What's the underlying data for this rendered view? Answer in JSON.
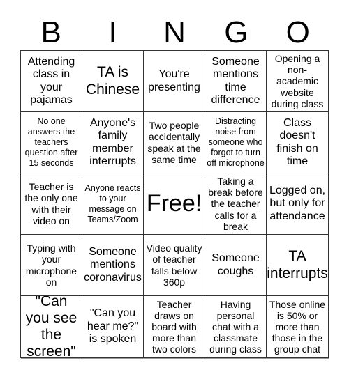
{
  "header": {
    "letters": [
      "B",
      "I",
      "N",
      "G",
      "O"
    ]
  },
  "card": {
    "cells": [
      {
        "text": "Attending class in your pajamas",
        "size": "m"
      },
      {
        "text": "TA is Chinese",
        "size": "l"
      },
      {
        "text": "You're presenting",
        "size": "m"
      },
      {
        "text": "Someone mentions time difference",
        "size": "m"
      },
      {
        "text": "Opening a non-academic website during class",
        "size": "sm"
      },
      {
        "text": "No one answers the teachers question after 15 seconds",
        "size": "s"
      },
      {
        "text": "Anyone's family member interrupts",
        "size": "m"
      },
      {
        "text": "Two people accidentally speak at the same time",
        "size": "sm"
      },
      {
        "text": "Distracting noise from someone who forgot to turn off microphone",
        "size": "s"
      },
      {
        "text": "Class doesn't finish on time",
        "size": "m"
      },
      {
        "text": "Teacher is the only one with their video on",
        "size": "sm"
      },
      {
        "text": "Anyone reacts to your message on Teams/Zoom",
        "size": "s"
      },
      {
        "text": "Free!",
        "size": "xl"
      },
      {
        "text": "Taking a break before the teacher calls for a break",
        "size": "sm"
      },
      {
        "text": "Logged on, but only for attendance",
        "size": "m"
      },
      {
        "text": "Typing with your microphone on",
        "size": "sm"
      },
      {
        "text": "Someone mentions coronavirus",
        "size": "m"
      },
      {
        "text": "Video quality of teacher falls below 360p",
        "size": "sm"
      },
      {
        "text": "Someone coughs",
        "size": "m"
      },
      {
        "text": "TA interrupts",
        "size": "l"
      },
      {
        "text": "\"Can you see the screen\"",
        "size": "l"
      },
      {
        "text": "\"Can you hear me?\" is spoken",
        "size": "m"
      },
      {
        "text": "Teacher draws on board with more than two colors",
        "size": "sm"
      },
      {
        "text": "Having personal chat with a classmate during class",
        "size": "sm"
      },
      {
        "text": "Those online is 50% or more than those in the group chat",
        "size": "sm"
      }
    ]
  }
}
